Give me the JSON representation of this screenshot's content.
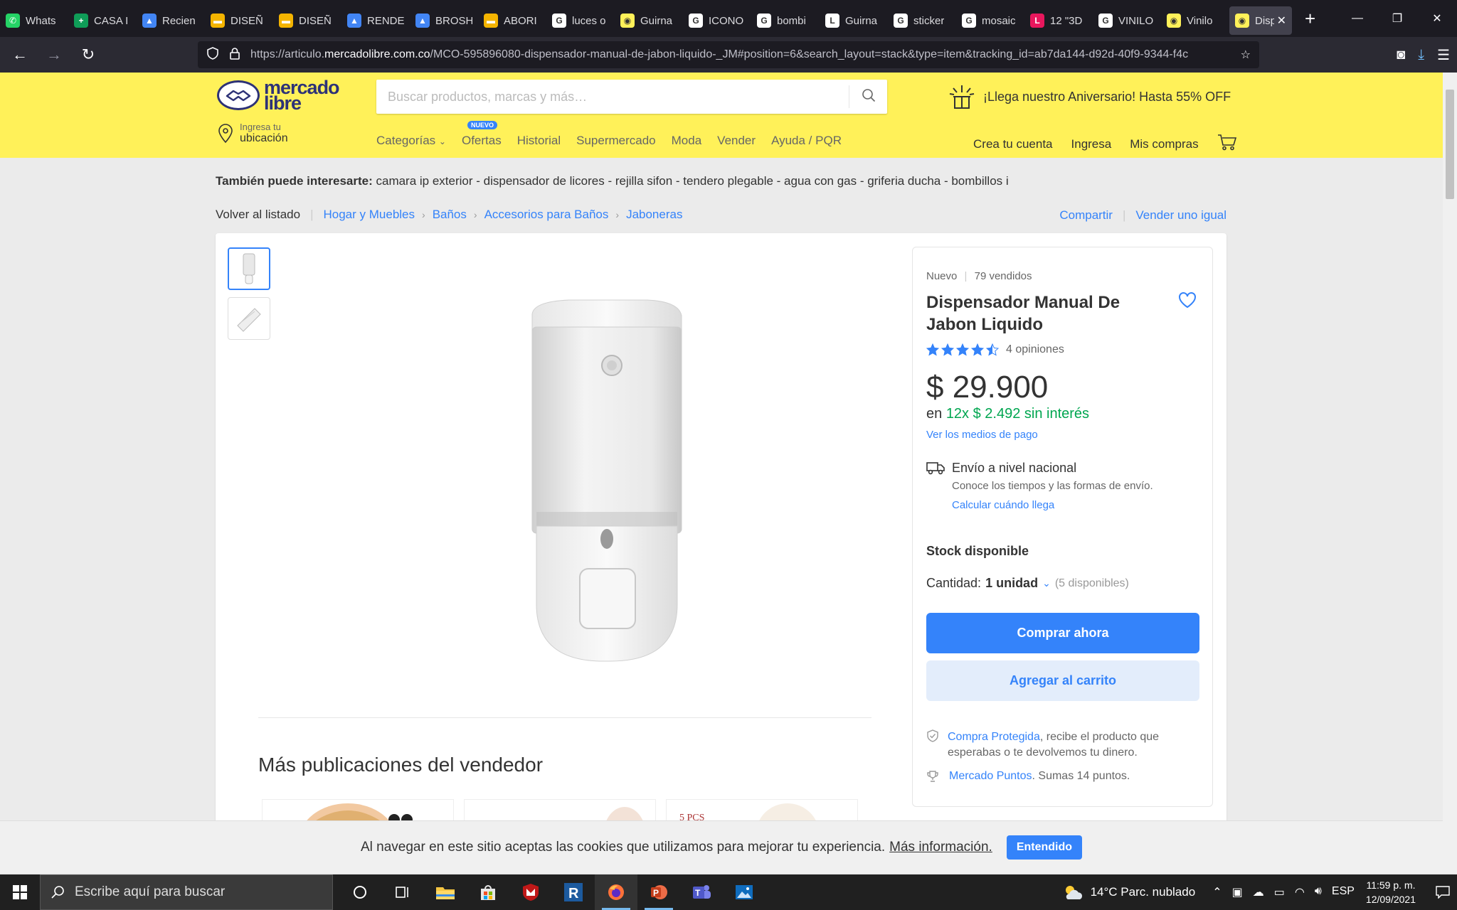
{
  "browser": {
    "tabs": [
      {
        "label": "Whats",
        "icon": "whatsapp-icon",
        "color": "#25d366",
        "glyph": "✆"
      },
      {
        "label": "CASA I",
        "icon": "sheets-icon",
        "color": "#0f9d58",
        "glyph": "+"
      },
      {
        "label": "Recien",
        "icon": "drive-icon",
        "color": "#4285f4",
        "glyph": "▲"
      },
      {
        "label": "DISEÑ",
        "icon": "slides-icon",
        "color": "#f4b400",
        "glyph": "▬"
      },
      {
        "label": "DISEÑ",
        "icon": "slides-icon",
        "color": "#f4b400",
        "glyph": "▬"
      },
      {
        "label": "RENDE",
        "icon": "drive-icon",
        "color": "#4285f4",
        "glyph": "▲"
      },
      {
        "label": "BROSH",
        "icon": "drive-icon",
        "color": "#4285f4",
        "glyph": "▲"
      },
      {
        "label": "ABORI",
        "icon": "slides-icon",
        "color": "#f4b400",
        "glyph": "▬"
      },
      {
        "label": "luces o",
        "icon": "google-icon",
        "color": "#ffffff",
        "glyph": "G"
      },
      {
        "label": "Guirna",
        "icon": "mercadolibre-icon",
        "color": "#fff159",
        "glyph": "◉"
      },
      {
        "label": "ICONO",
        "icon": "google-icon",
        "color": "#ffffff",
        "glyph": "G"
      },
      {
        "label": "bombi",
        "icon": "google-icon",
        "color": "#ffffff",
        "glyph": "G"
      },
      {
        "label": "Guirna",
        "icon": "page-icon",
        "color": "#ffffff",
        "glyph": "L"
      },
      {
        "label": "sticker",
        "icon": "google-icon",
        "color": "#ffffff",
        "glyph": "G"
      },
      {
        "label": "mosaic",
        "icon": "google-icon",
        "color": "#ffffff",
        "glyph": "G"
      },
      {
        "label": "12 \"3D",
        "icon": "linio-icon",
        "color": "#e8175d",
        "glyph": "L"
      },
      {
        "label": "VINILO",
        "icon": "google-icon",
        "color": "#ffffff",
        "glyph": "G"
      },
      {
        "label": "Vinilo",
        "icon": "mercadolibre-icon",
        "color": "#fff159",
        "glyph": "◉"
      },
      {
        "label": "Disp",
        "icon": "mercadolibre-icon",
        "color": "#fff159",
        "glyph": "◉",
        "active": true
      }
    ],
    "url_prefix": "https://articulo.",
    "url_domain": "mercadolibre.com.co",
    "url_rest": "/MCO-595896080-dispensador-manual-de-jabon-liquido-_JM#position=6&search_layout=stack&type=item&tracking_id=ab7da144-d92d-40f9-9344-f4c"
  },
  "header": {
    "logo_line1": "mercado",
    "logo_line2": "libre",
    "search_placeholder": "Buscar productos, marcas y más…",
    "promo": "¡Llega nuestro Aniversario! Hasta 55% OFF",
    "location_small": "Ingresa tu",
    "location_big": "ubicación",
    "menu": [
      "Categorías",
      "Ofertas",
      "Historial",
      "Supermercado",
      "Moda",
      "Vender",
      "Ayuda / PQR"
    ],
    "menu_badge": "NUEVO",
    "account": [
      "Crea tu cuenta",
      "Ingresa",
      "Mis compras"
    ]
  },
  "interest": {
    "label": "También puede interesarte:",
    "items": "camara ip exterior - dispensador de licores - rejilla sifon - tendero plegable - agua con gas - griferia ducha - bombillos i"
  },
  "breadcrumbs": {
    "back": "Volver al listado",
    "items": [
      "Hogar y Muebles",
      "Baños",
      "Accesorios para Baños",
      "Jaboneras"
    ],
    "share": "Compartir",
    "sell_same": "Vender uno igual"
  },
  "product": {
    "condition": "Nuevo",
    "sold": "79 vendidos",
    "title": "Dispensador Manual De Jabon Liquido",
    "rating": 4.5,
    "reviews": "4 opiniones",
    "price": "$ 29.900",
    "installments_prefix": "en",
    "installments": "12x $ 2.492 sin interés",
    "payment_link": "Ver los medios de pago",
    "shipping_title": "Envío a nivel nacional",
    "shipping_sub": "Conoce los tiempos y las formas de envío.",
    "shipping_link": "Calcular cuándo llega",
    "stock": "Stock disponible",
    "qty_label": "Cantidad:",
    "qty_value": "1 unidad",
    "qty_available": "(5 disponibles)",
    "buy_now": "Comprar ahora",
    "add_cart": "Agregar al carrito",
    "protected_link": "Compra Protegida",
    "protected_text": ", recibe el producto que esperabas o te devolvemos tu dinero.",
    "points_link": "Mercado Puntos",
    "points_text": ". Sumas 14 puntos."
  },
  "seller_section": {
    "title": "Más publicaciones del vendedor",
    "card3_text": "5 PCS"
  },
  "cookie": {
    "text": "Al navegar en este sitio aceptas las cookies que utilizamos para mejorar tu experiencia.",
    "link": "Más información.",
    "button": "Entendido"
  },
  "taskbar": {
    "search_placeholder": "Escribe aquí para buscar",
    "weather": "14°C  Parc. nublado",
    "lang": "ESP",
    "time": "11:59 p. m.",
    "date": "12/09/2021"
  },
  "colors": {
    "brand_yellow": "#fff159",
    "accent_blue": "#3483fa",
    "price_green": "#00a650"
  }
}
